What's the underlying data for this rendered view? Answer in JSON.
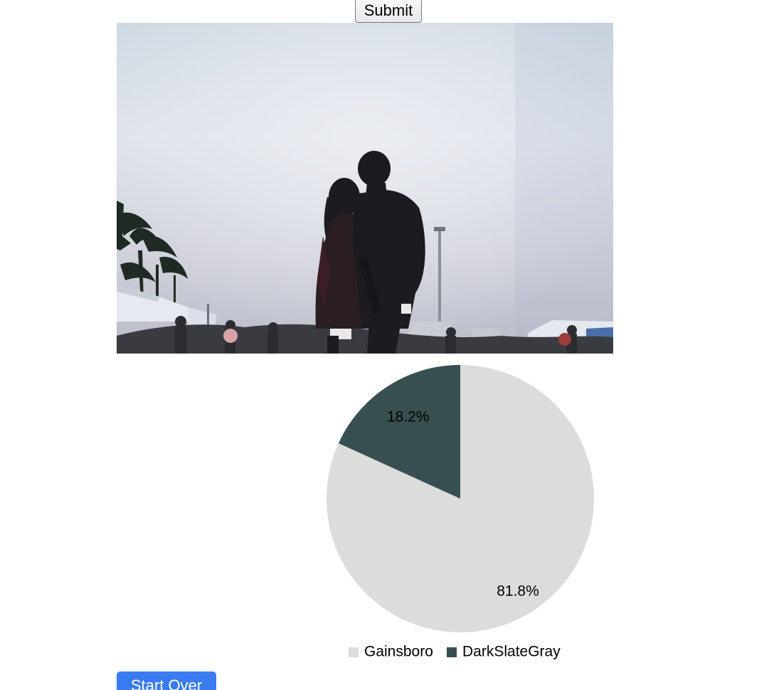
{
  "form": {
    "submit_label": "Submit"
  },
  "photo": {
    "subject": "silhouette couple kissing under overcast sky at outdoor event"
  },
  "chart_data": {
    "type": "pie",
    "categories": [
      "Gainsboro",
      "DarkSlateGray"
    ],
    "values": [
      81.8,
      18.2
    ],
    "labels": [
      "81.8%",
      "18.2%"
    ],
    "colors": [
      "#dcdcdc",
      "#374f50"
    ],
    "title": "",
    "legend": "bottom"
  },
  "actions": {
    "start_over_label": "Start Over"
  }
}
